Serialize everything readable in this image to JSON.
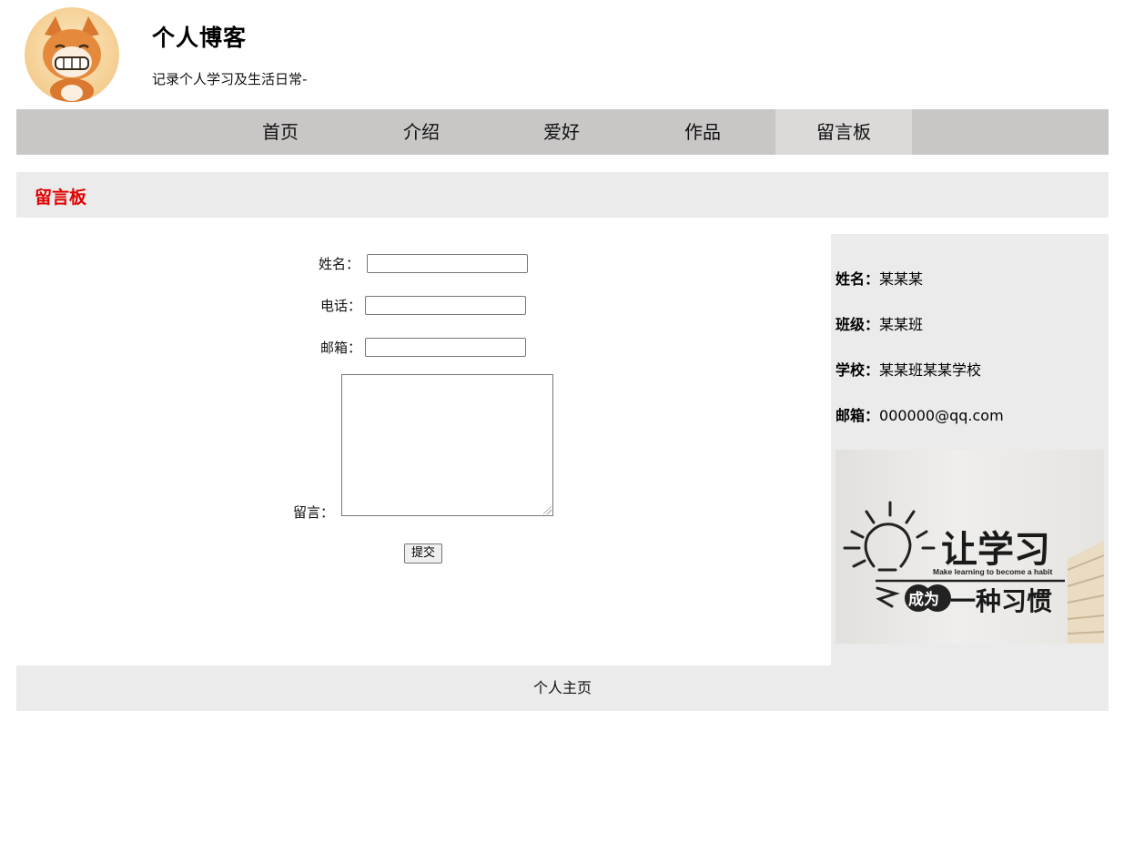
{
  "header": {
    "title": "个人博客",
    "subtitle": "记录个人学习及生活日常-"
  },
  "nav": {
    "items": [
      {
        "label": "首页"
      },
      {
        "label": "介绍"
      },
      {
        "label": "爱好"
      },
      {
        "label": "作品"
      },
      {
        "label": "留言板"
      }
    ],
    "active": "留言板"
  },
  "section": {
    "title": "留言板"
  },
  "form": {
    "name_label": "姓名：",
    "phone_label": "电话：",
    "email_label": "邮箱：",
    "message_label": "留言：",
    "name_value": "",
    "phone_value": "",
    "email_value": "",
    "message_value": "",
    "submit_label": "提交"
  },
  "sidebar": {
    "name_key": "姓名：",
    "name_val": "某某某",
    "class_key": "班级：",
    "class_val": "某某班",
    "school_key": "学校：",
    "school_val": "某某班某某学校",
    "email_key": "邮箱：",
    "email_val": "000000@qq.com",
    "banner": {
      "main": "让学习",
      "en": "Make learning to become a habit",
      "badge": "成为",
      "tail": "一种习惯"
    }
  },
  "footer": {
    "text": "个人主页"
  },
  "colors": {
    "nav_bg": "#c9c6c6",
    "nav_active_bg": "#dcd9d9",
    "panel_bg": "#ecebeb",
    "section_title": "#e00000"
  }
}
